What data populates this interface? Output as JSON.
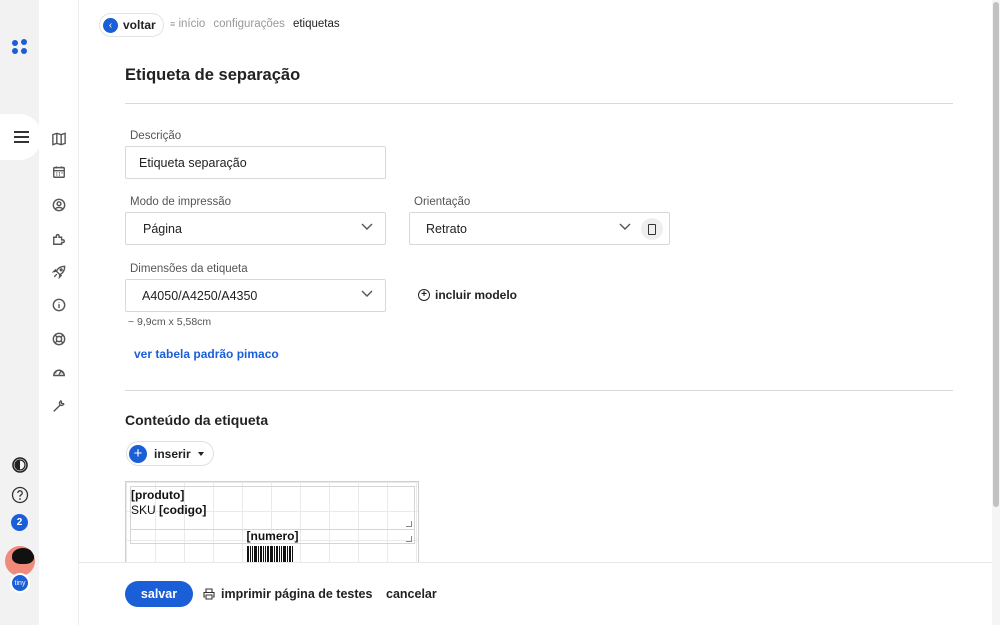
{
  "breadcrumb": {
    "back_label": "voltar",
    "items": [
      "início",
      "configurações",
      "etiquetas"
    ]
  },
  "page": {
    "title": "Etiqueta de separação"
  },
  "form": {
    "description": {
      "label": "Descrição",
      "value": "Etiqueta separação"
    },
    "print_mode": {
      "label": "Modo de impressão",
      "value": "Página"
    },
    "orientation": {
      "label": "Orientação",
      "value": "Retrato"
    },
    "dimensions": {
      "label": "Dimensões da etiqueta",
      "value": "A4050/A4250/A4350",
      "hint": "~ 9,9cm x 5,58cm"
    },
    "add_model_label": "incluir modelo",
    "pimaco_link": "ver tabela padrão pimaco"
  },
  "content": {
    "title": "Conteúdo da etiqueta",
    "insert_label": "inserir",
    "preview": {
      "line1": "[produto]",
      "line2_prefix": "SKU ",
      "line2_field": "[codigo]",
      "line3": "[numero]"
    }
  },
  "footer": {
    "save_label": "salvar",
    "print_test_label": "imprimir página de testes",
    "cancel_label": "cancelar"
  },
  "sidebar": {
    "notification_count": "2",
    "brand_badge": "tiny",
    "icons": [
      "map-icon",
      "calendar-icon",
      "user-circle-icon",
      "puzzle-icon",
      "rocket-icon",
      "info-icon",
      "lifebuoy-icon",
      "dashboard-icon",
      "wrench-icon"
    ]
  },
  "colors": {
    "accent": "#1a5fd8"
  }
}
